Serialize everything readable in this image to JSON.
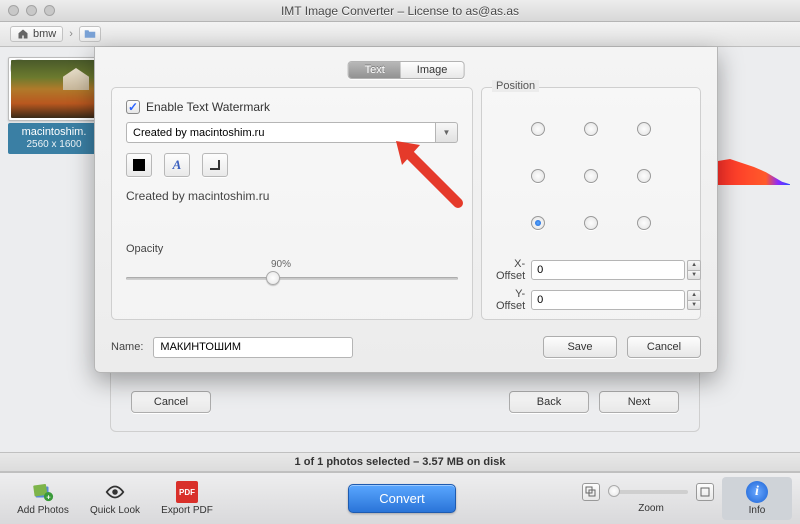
{
  "window": {
    "title": "IMT Image Converter – License to as@as.as"
  },
  "breadcrumbs": {
    "home": "bmw"
  },
  "thumbnail": {
    "name": "macintoshim.",
    "dims": "2560 x 1600"
  },
  "sheet": {
    "tab_text": "Text",
    "tab_image": "Image",
    "enable_label": "Enable Text Watermark",
    "watermark_text": "Created by macintoshim.ru",
    "preview_text": "Created by macintoshim.ru",
    "opacity_label": "Opacity",
    "opacity_pct": "90%",
    "position_label": "Position",
    "x_offset_label": "X-Offset",
    "x_offset_value": "0",
    "y_offset_label": "Y-Offset",
    "y_offset_value": "0",
    "name_label": "Name:",
    "name_value": "МАКИНТОШИМ",
    "save": "Save",
    "cancel": "Cancel"
  },
  "wizard": {
    "cancel": "Cancel",
    "back": "Back",
    "next": "Next"
  },
  "status": {
    "text": "1 of 1 photos selected – 3.57 MB on disk"
  },
  "toolbar": {
    "add_photos": "Add Photos",
    "quick_look": "Quick Look",
    "export_pdf": "Export PDF",
    "convert": "Convert",
    "zoom": "Zoom",
    "info": "Info"
  }
}
